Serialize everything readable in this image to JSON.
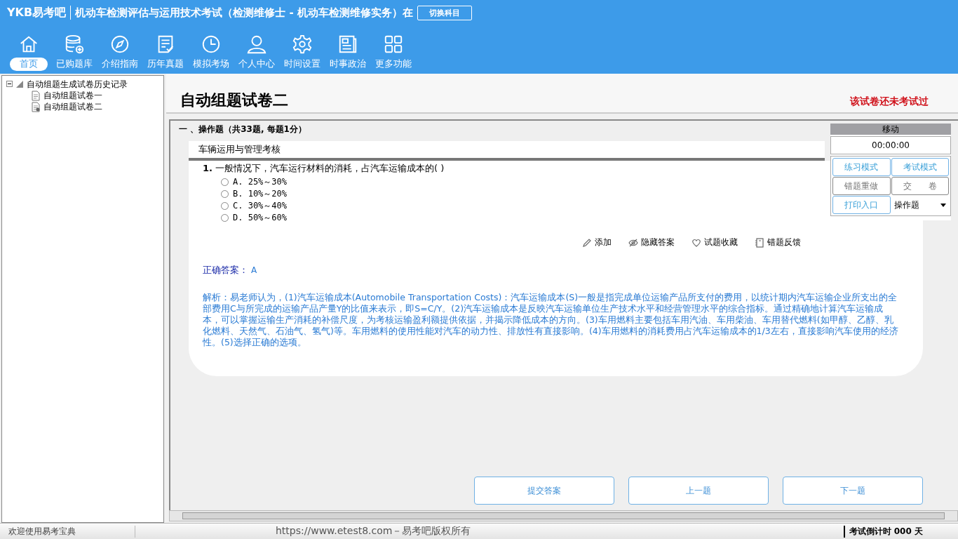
{
  "header": {
    "logo": "YKB易考吧",
    "title": "机动车检测评估与运用技术考试（检测维修士 - 机动车检测维修实务）在",
    "switch_button": "切换科目"
  },
  "nav": [
    {
      "label": "首页",
      "selected": true
    },
    {
      "label": "已购题库",
      "selected": false
    },
    {
      "label": "介绍指南",
      "selected": false
    },
    {
      "label": "历年真题",
      "selected": false
    },
    {
      "label": "模拟考场",
      "selected": false
    },
    {
      "label": "个人中心",
      "selected": false
    },
    {
      "label": "时间设置",
      "selected": false
    },
    {
      "label": "时事政治",
      "selected": false
    },
    {
      "label": "更多功能",
      "selected": false
    }
  ],
  "tree": {
    "label": "自动组题生成试卷历史记录",
    "expanded": true,
    "children": [
      {
        "label": "自动组题试卷一"
      },
      {
        "label": "自动组题试卷二"
      }
    ]
  },
  "paper": {
    "title": "自动组题试卷二",
    "status": "该试卷还未考试过",
    "section": "一 、操作题（共33题, 每题1分）",
    "category": "车辆运用与管理考核"
  },
  "question": {
    "number": "1.",
    "text": "一般情况下，汽车运行材料的消耗，占汽车运输成本的(  )",
    "options": [
      {
        "label": "A. 25%～30%",
        "selected": false
      },
      {
        "label": "B. 10%～20%",
        "selected": false
      },
      {
        "label": "C. 30%～40%",
        "selected": false
      },
      {
        "label": "D. 50%～60%",
        "selected": false
      }
    ],
    "tools": [
      "添加",
      "隐藏答案",
      "试题收藏",
      "错题反馈"
    ],
    "answer_label": "正确答案：",
    "answer": "A",
    "explanation": "解析：易老师认为，(1)汽车运输成本(Automobile Transportation Costs)：汽车运输成本(S)一般是指完成单位运输产品所支付的费用，以统计期内汽车运输企业所支出的全部费用C与所完成的运输产品产量Y的比值来表示，即S=C/Y。(2)汽车运输成本是反映汽车运输单位生产技术水平和经营管理水平的综合指标。通过精确地计算汽车运输成本，可以掌握运输生产消耗的补偿尺度，为考核运输盈利额提供依据，并揭示降低成本的方向。(3)车用燃料主要包括车用汽油、车用柴油、车用替代燃料(如甲醇、乙醇、乳化燃料、天然气、石油气、氢气)等。车用燃料的使用性能对汽车的动力性、排放性有直接影响。(4)车用燃料的消耗费用占汽车运输成本的1/3左右，直接影响汽车使用的经济性。(5)选择正确的选项。"
  },
  "panel": {
    "handle": "移动",
    "timer": "00:00:00",
    "buttons": [
      {
        "label": "练习模式",
        "kind": "blue"
      },
      {
        "label": "考试模式",
        "kind": "blue"
      },
      {
        "label": "错题重做",
        "kind": "grey"
      },
      {
        "label": "交　　卷",
        "kind": "grey"
      },
      {
        "label": "打印入口",
        "kind": "blue"
      }
    ],
    "select": "操作题"
  },
  "actions": [
    "提交答案",
    "上一题",
    "下一题"
  ],
  "status_bar": {
    "welcome": "欢迎使用易考宝典",
    "copyright": "https://www.etest8.com－易考吧版权所有",
    "countdown": "考试倒计时 000 天"
  }
}
